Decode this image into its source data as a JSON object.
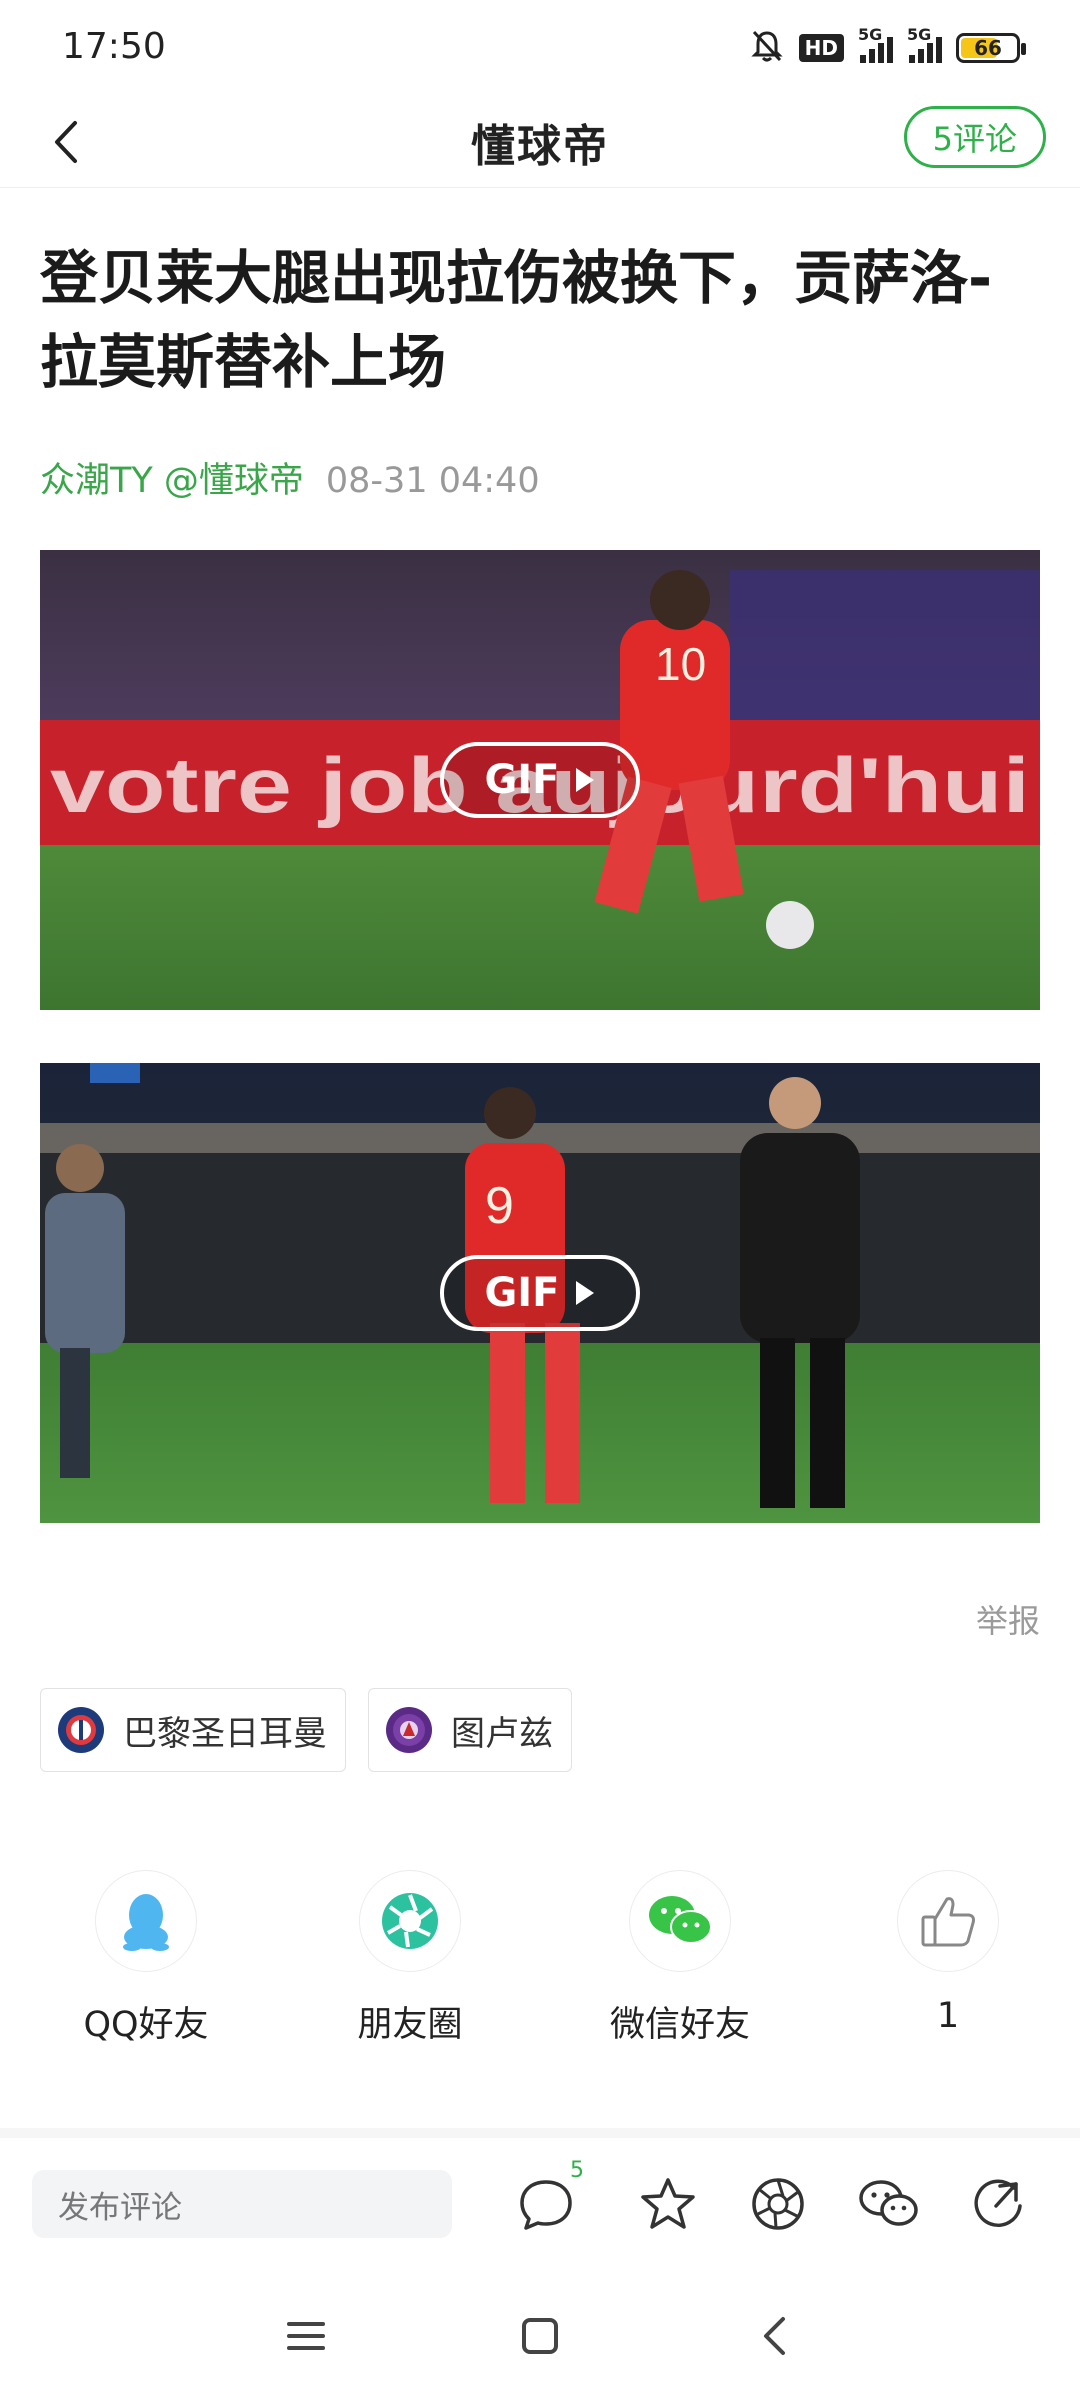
{
  "status_bar": {
    "time": "17:50",
    "hd": "HD",
    "net1": "5G",
    "net2": "5G",
    "battery": "66"
  },
  "header": {
    "title": "懂球帝",
    "comment_pill": "5评论"
  },
  "article": {
    "title": "登贝莱大腿出现拉伤被换下，贡萨洛-拉莫斯替补上场",
    "source": "众潮TY @懂球帝",
    "date": "08-31 04:40",
    "media": [
      {
        "badge": "GIF",
        "banner_text": "votre job aujourd'hui",
        "jersey": "10"
      },
      {
        "badge": "GIF",
        "jersey": "9"
      }
    ],
    "report": "举报"
  },
  "tags": [
    {
      "label": "巴黎圣日耳曼",
      "logo": "psg-logo"
    },
    {
      "label": "图卢兹",
      "logo": "toulouse-logo"
    }
  ],
  "share": [
    {
      "label": "QQ好友",
      "icon": "qq-icon"
    },
    {
      "label": "朋友圈",
      "icon": "moments-icon"
    },
    {
      "label": "微信好友",
      "icon": "wechat-icon"
    },
    {
      "label": "1",
      "icon": "thumbs-up-icon"
    }
  ],
  "toolbar": {
    "comment_placeholder": "发布评论",
    "comment_count": "5"
  },
  "colors": {
    "accent": "#2fb14a",
    "meta_green": "#3aa64a",
    "muted": "#999999"
  }
}
